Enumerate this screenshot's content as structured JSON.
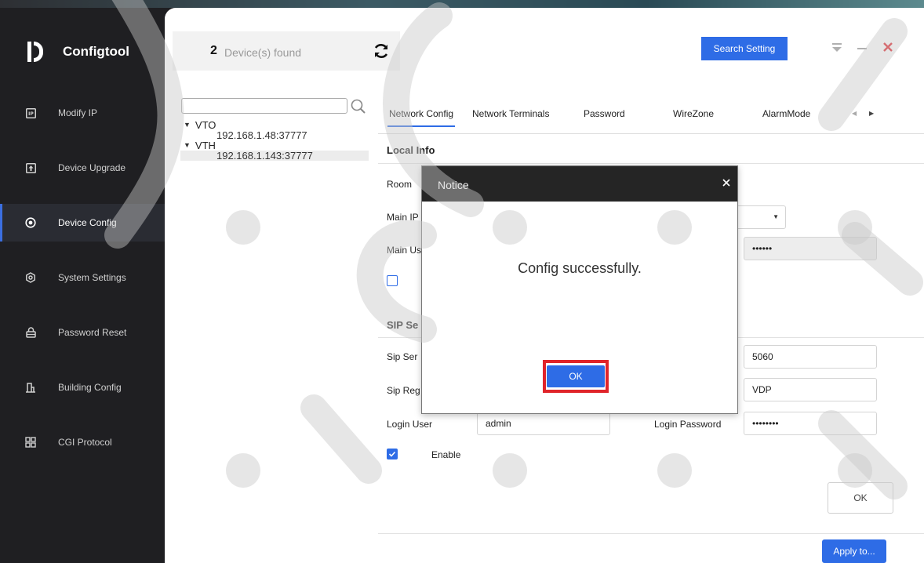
{
  "app": {
    "name": "Configtool"
  },
  "sidebar": {
    "items": [
      {
        "label": "Modify IP",
        "icon": "ip-icon"
      },
      {
        "label": "Device Upgrade",
        "icon": "upgrade-icon"
      },
      {
        "label": "Device Config",
        "icon": "config-icon",
        "active": true
      },
      {
        "label": "System Settings",
        "icon": "settings-icon"
      },
      {
        "label": "Password Reset",
        "icon": "lock-icon"
      },
      {
        "label": "Building Config",
        "icon": "building-icon"
      },
      {
        "label": "CGI Protocol",
        "icon": "cgi-icon"
      }
    ]
  },
  "header": {
    "device_count": "2",
    "device_found_label": "Device(s) found",
    "search_setting_label": "Search Setting"
  },
  "tree": {
    "search_value": "",
    "groups": [
      {
        "label": "VTO",
        "nodes": [
          "192.168.1.48:37777"
        ]
      },
      {
        "label": "VTH",
        "nodes": [
          "192.168.1.143:37777"
        ]
      }
    ]
  },
  "tabs": [
    "Network Config",
    "Network Terminals",
    "Password",
    "WireZone",
    "AlarmMode"
  ],
  "form": {
    "local_info_title": "Local Info",
    "room_label": "Room",
    "main_ip_label": "Main IP",
    "main_user_label": "Main Us",
    "main_password_value": "••••••",
    "sip_title": "SIP Se",
    "sip_server_label": "Sip Ser",
    "sip_server_port_value": "5060",
    "sip_reg_label": "Sip Reg",
    "sip_reg_value": "VDP",
    "login_user_label": "Login User",
    "login_user_value": "admin",
    "login_password_label": "Login Password",
    "login_password_value": "••••••••",
    "enable_label": "Enable",
    "ok_label": "OK",
    "apply_label": "Apply to..."
  },
  "modal": {
    "title": "Notice",
    "message": "Config successfully.",
    "ok_label": "OK"
  },
  "colors": {
    "accent": "#2e6ce6",
    "highlight": "#e0242a",
    "sidebar_bg": "#1f1f22"
  }
}
